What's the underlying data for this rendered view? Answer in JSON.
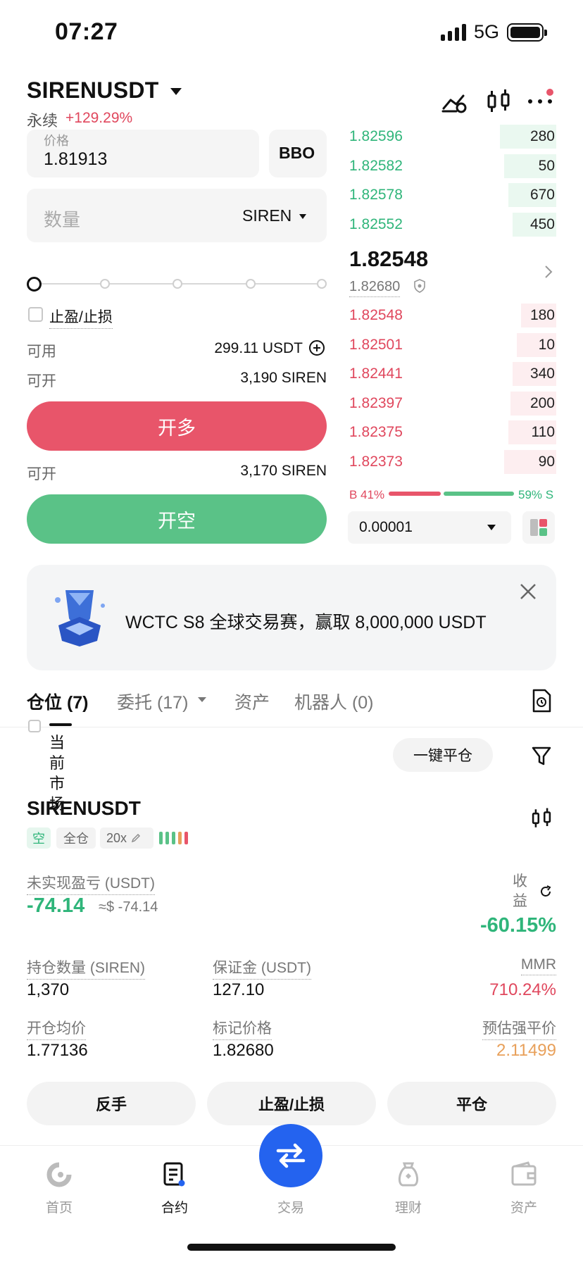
{
  "status_bar": {
    "time": "07:27",
    "network": "5G"
  },
  "header": {
    "symbol": "SIRENUSDT",
    "contract_type": "永续",
    "change_pct": "+129.29%"
  },
  "order_form": {
    "price_label": "价格",
    "price_value": "1.81913",
    "bbo_label": "BBO",
    "quantity_placeholder": "数量",
    "quantity_unit": "SIREN",
    "tp_sl_label": "止盈/止损",
    "available_label": "可用",
    "available_value": "299.11 USDT",
    "max_open_label": "可开",
    "max_open_long": "3,190 SIREN",
    "max_open_short": "3,170 SIREN",
    "long_button": "开多",
    "short_button": "开空"
  },
  "order_book": {
    "asks": [
      {
        "price": "1.82596",
        "qty": "280",
        "depth": 0.27
      },
      {
        "price": "1.82582",
        "qty": "50",
        "depth": 0.25
      },
      {
        "price": "1.82578",
        "qty": "670",
        "depth": 0.23
      },
      {
        "price": "1.82552",
        "qty": "450",
        "depth": 0.21
      }
    ],
    "last_price": "1.82548",
    "mark_price": "1.82680",
    "bids": [
      {
        "price": "1.82548",
        "qty": "180",
        "depth": 0.17
      },
      {
        "price": "1.82501",
        "qty": "10",
        "depth": 0.19
      },
      {
        "price": "1.82441",
        "qty": "340",
        "depth": 0.21
      },
      {
        "price": "1.82397",
        "qty": "200",
        "depth": 0.22
      },
      {
        "price": "1.82375",
        "qty": "110",
        "depth": 0.23
      },
      {
        "price": "1.82373",
        "qty": "90",
        "depth": 0.25
      }
    ],
    "buy_ratio": "B 41%",
    "sell_ratio": "59% S",
    "buy_ratio_value": 0.41,
    "precision": "0.00001"
  },
  "banner": {
    "text": "WCTC S8 全球交易赛，赢取 8,000,000 USDT"
  },
  "tabs": [
    {
      "label": "仓位 (7)"
    },
    {
      "label": "委托 (17)"
    },
    {
      "label": "资产"
    },
    {
      "label": "机器人 (0)"
    }
  ],
  "positions_toolbar": {
    "current_market": "当前市场",
    "close_all": "一键平仓"
  },
  "position": {
    "symbol": "SIRENUSDT",
    "side_tag": "空",
    "margin_mode": "全仓",
    "leverage": "20x",
    "unrealized_pnl_label": "未实现盈亏 (USDT)",
    "unrealized_pnl": "-74.14",
    "unrealized_pnl_usd": "≈$ -74.14",
    "roe_label": "收益",
    "roe_value": "-60.15%",
    "size_label": "持仓数量 (SIREN)",
    "size_value": "1,370",
    "margin_label": "保证金 (USDT)",
    "margin_value": "127.10",
    "mmr_label": "MMR",
    "mmr_value": "710.24%",
    "entry_label": "开仓均价",
    "entry_value": "1.77136",
    "mark_label": "标记价格",
    "mark_value": "1.82680",
    "liq_label": "预估强平价",
    "liq_value": "2.11499",
    "reverse_button": "反手",
    "tpsl_button": "止盈/止损",
    "close_button": "平仓"
  },
  "bottom_nav": [
    {
      "label": "首页"
    },
    {
      "label": "合约"
    },
    {
      "label": "交易"
    },
    {
      "label": "理财"
    },
    {
      "label": "资产"
    }
  ],
  "colors": {
    "red": "#e8556a",
    "green": "#5ac287",
    "brand_blue": "#2463ef",
    "orange": "#e8a05a"
  }
}
